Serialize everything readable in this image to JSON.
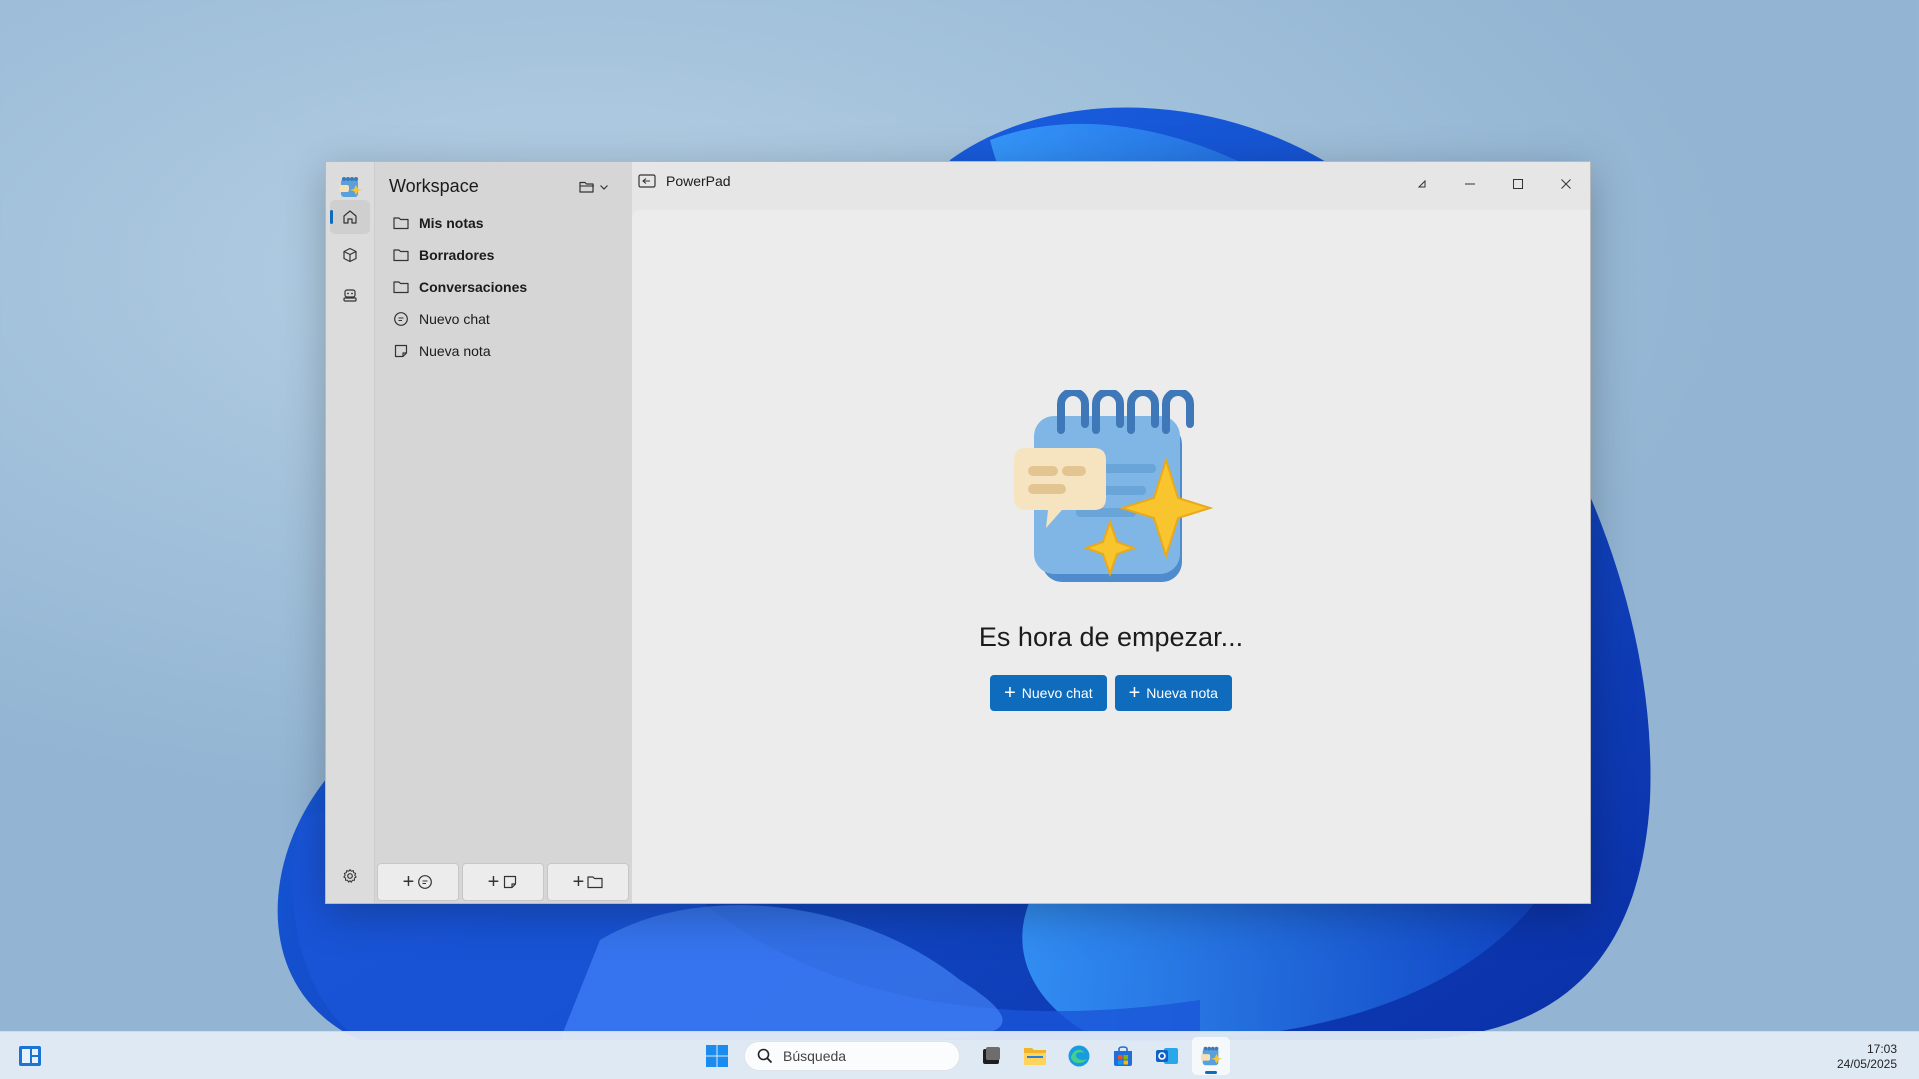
{
  "window": {
    "workspace_title": "Workspace",
    "tab_title": "PowerPad",
    "tree": [
      {
        "label": "Mis notas",
        "icon": "folder-icon",
        "bold": true
      },
      {
        "label": "Borradores",
        "icon": "folder-icon",
        "bold": true
      },
      {
        "label": "Conversaciones",
        "icon": "folder-icon",
        "bold": true
      },
      {
        "label": "Nuevo chat",
        "icon": "chat-icon",
        "bold": false
      },
      {
        "label": "Nueva nota",
        "icon": "note-icon",
        "bold": false
      }
    ],
    "bottom_buttons": [
      {
        "label": "+",
        "icon": "chat-icon"
      },
      {
        "label": "+",
        "icon": "note-icon"
      },
      {
        "label": "+",
        "icon": "folder-icon"
      }
    ]
  },
  "content": {
    "heading": "Es hora de empezar...",
    "new_chat_label": "Nuevo chat",
    "new_note_label": "Nueva nota",
    "plus": "+"
  },
  "taskbar": {
    "search_placeholder": "Búsqueda",
    "time": "17:03",
    "date": "24/05/2025"
  },
  "colors": {
    "accent": "#0f6cbd",
    "window_bg": "#e6e6e6",
    "sidebar_bg": "#d6d6d6"
  }
}
